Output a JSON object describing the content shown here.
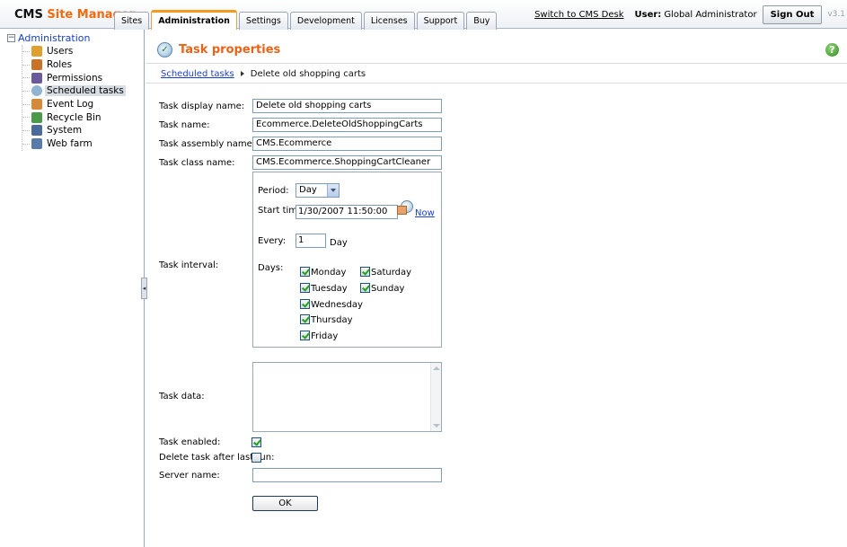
{
  "header": {
    "brand_cms": "CMS",
    "brand_name": "Site Manager",
    "tabs": [
      "Sites",
      "Administration",
      "Settings",
      "Development",
      "Licenses",
      "Support",
      "Buy"
    ],
    "active_tab": "Administration",
    "switch_link": "Switch to CMS Desk",
    "user_label": "User:",
    "user_name": "Global Administrator",
    "sign_out": "Sign Out",
    "version": "v3.1"
  },
  "sidebar": {
    "root": "Administration",
    "items": [
      {
        "label": "Users",
        "icon": "users-icon",
        "color": "#e0a030"
      },
      {
        "label": "Roles",
        "icon": "roles-icon",
        "color": "#c8732a"
      },
      {
        "label": "Permissions",
        "icon": "permissions-icon",
        "color": "#6a5a9a"
      },
      {
        "label": "Scheduled tasks",
        "icon": "clock-icon",
        "color": "#8fb4d4"
      },
      {
        "label": "Event Log",
        "icon": "event-log-icon",
        "color": "#d48a3a"
      },
      {
        "label": "Recycle Bin",
        "icon": "recycle-bin-icon",
        "color": "#4a9a4a"
      },
      {
        "label": "System",
        "icon": "system-icon",
        "color": "#4a6a9a"
      },
      {
        "label": "Web farm",
        "icon": "web-farm-icon",
        "color": "#5a7aaa"
      }
    ],
    "selected": "Scheduled tasks"
  },
  "main": {
    "title": "Task properties",
    "breadcrumb": {
      "link": "Scheduled tasks",
      "current": "Delete old shopping carts"
    },
    "form": {
      "display_name_label": "Task display name:",
      "display_name_value": "Delete old shopping carts",
      "task_name_label": "Task name:",
      "task_name_value": "Ecommerce.DeleteOldShoppingCarts",
      "assembly_label": "Task assembly name:",
      "assembly_value": "CMS.Ecommerce",
      "class_label": "Task class name:",
      "class_value": "CMS.Ecommerce.ShoppingCartCleaner",
      "interval_label": "Task interval:",
      "period_label": "Period:",
      "period_value": "Day",
      "start_label": "Start time:",
      "start_value": "1/30/2007 11:50:00",
      "now_link": "Now",
      "every_label": "Every:",
      "every_value": "1",
      "every_unit": "Day",
      "days_label": "Days:",
      "days": [
        {
          "label": "Monday",
          "checked": true
        },
        {
          "label": "Tuesday",
          "checked": true
        },
        {
          "label": "Wednesday",
          "checked": true
        },
        {
          "label": "Thursday",
          "checked": true
        },
        {
          "label": "Friday",
          "checked": true
        },
        {
          "label": "Saturday",
          "checked": true
        },
        {
          "label": "Sunday",
          "checked": true
        }
      ],
      "data_label": "Task data:",
      "data_value": "",
      "enabled_label": "Task enabled:",
      "enabled": true,
      "delete_label": "Delete task after last run:",
      "delete_after": false,
      "server_label": "Server name:",
      "server_value": "",
      "ok_button": "OK"
    }
  }
}
